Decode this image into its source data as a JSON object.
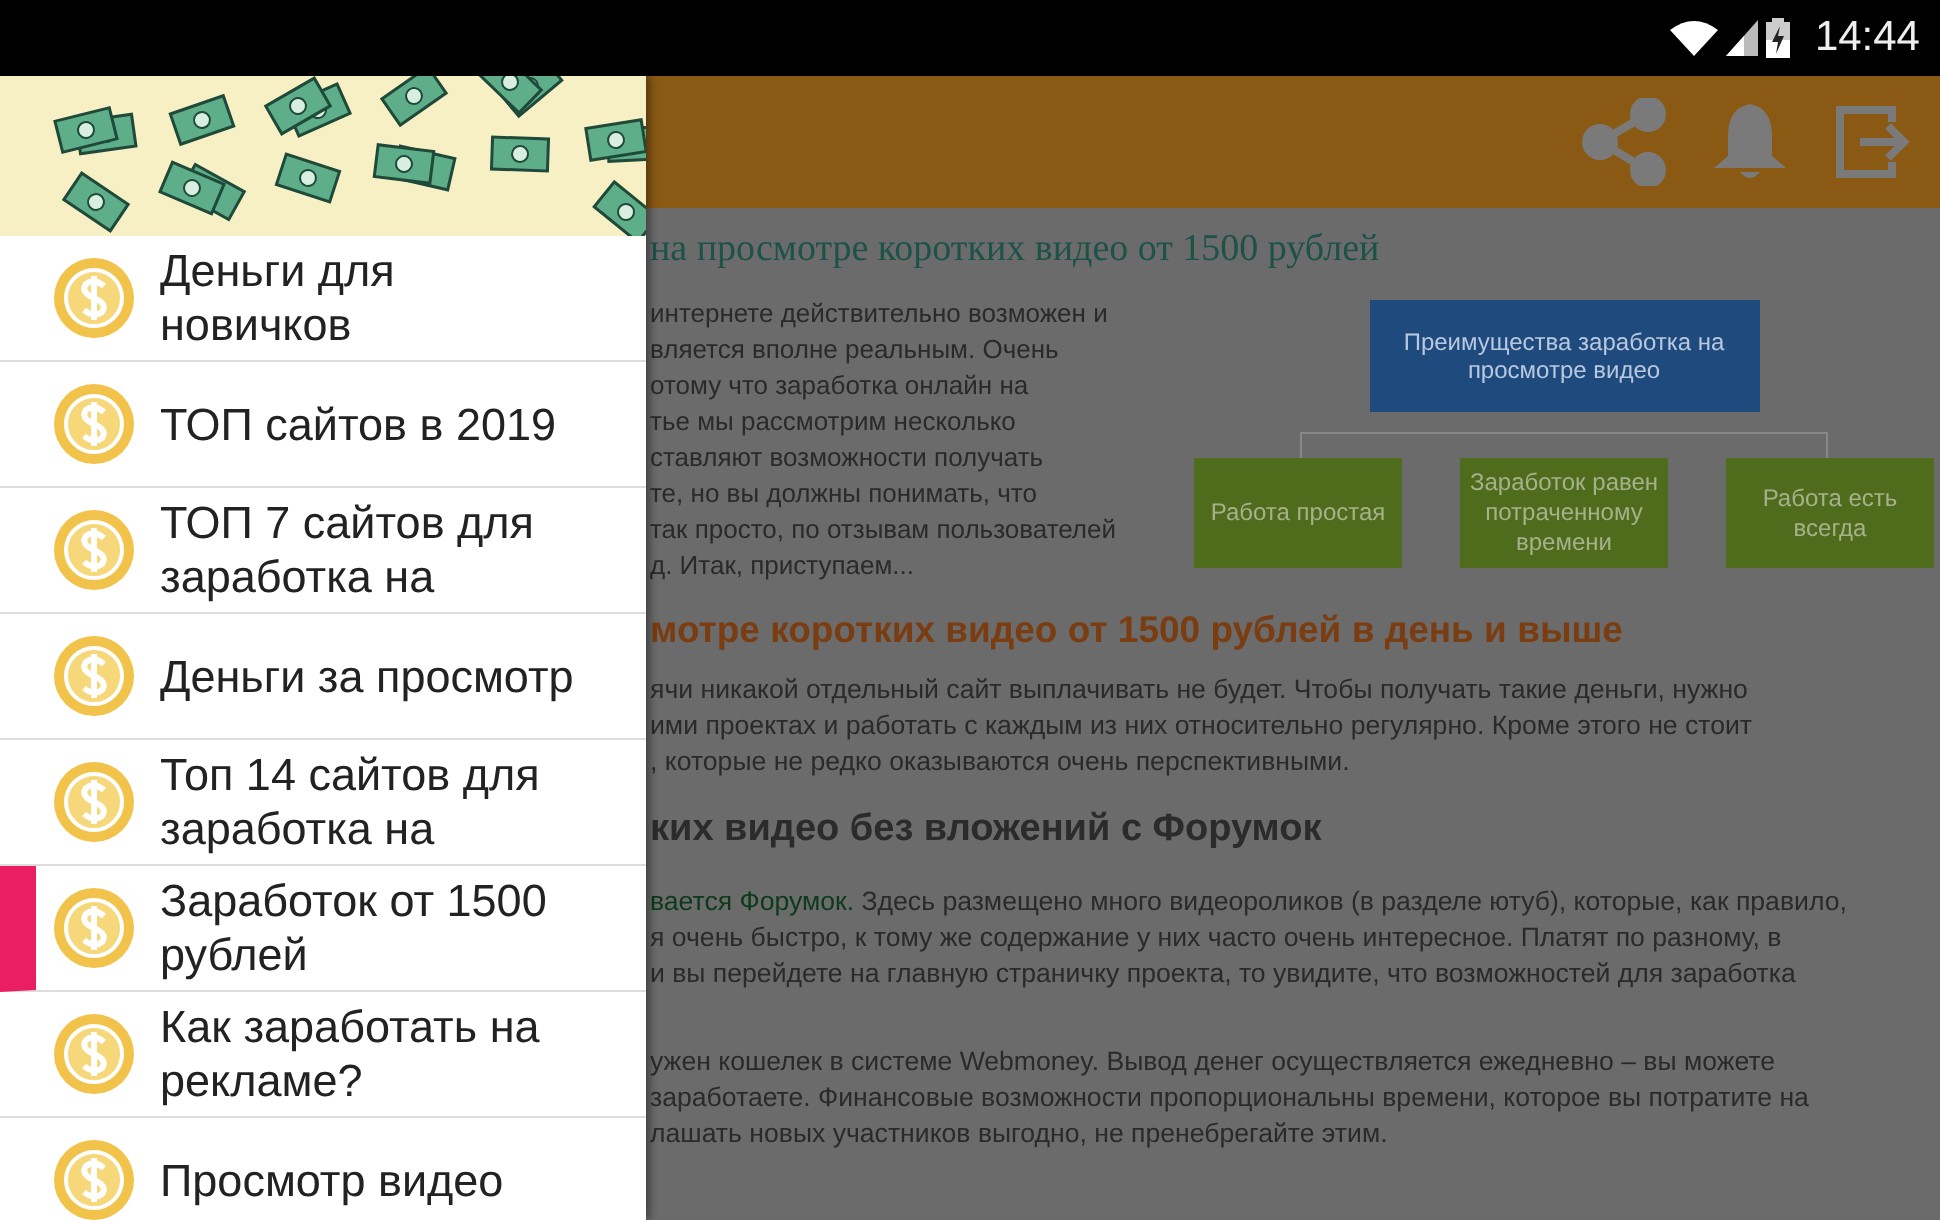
{
  "status_bar": {
    "time": "14:44"
  },
  "drawer": {
    "items": [
      {
        "label": "Деньги для новичков",
        "selected": false
      },
      {
        "label": "ТОП сайтов в 2019",
        "selected": false
      },
      {
        "label": "ТОП 7 сайтов для заработка на",
        "selected": false
      },
      {
        "label": "Деньги за просмотр",
        "selected": false
      },
      {
        "label": "Топ 14 сайтов для заработка на",
        "selected": false
      },
      {
        "label": "Заработок от 1500 рублей",
        "selected": true
      },
      {
        "label": "Как заработать на рекламе?",
        "selected": false
      },
      {
        "label": "Просмотр видео",
        "selected": false
      }
    ]
  },
  "article": {
    "title": "на просмотре коротких видео от 1500 рублей",
    "intro": [
      "интернете действительно возможен и",
      "вляется вполне реальным. Очень",
      "отому что заработка онлайн на",
      "тье мы рассмотрим несколько",
      "ставляют возможности получать",
      "те, но вы должны понимать, что",
      "так просто, по отзывам пользователей",
      "д. Итак, приступаем..."
    ],
    "diagram": {
      "root": "Преимущества заработка на просмотре видео",
      "leaves": [
        "Работа простая",
        "Заработок равен потраченному времени",
        "Работа есть всегда"
      ]
    },
    "heading_2": "мотре коротких видео от 1500 рублей в день и выше",
    "paragraph_2": [
      "ячи никакой отдельный сайт выплачивать не будет. Чтобы получать такие деньги, нужно",
      "ими проектах и работать с каждым из них относительно регулярно. Кроме этого не стоит",
      ", которые не редко оказываются очень перспективными."
    ],
    "heading_3": "ких видео без вложений с Форумок",
    "paragraph_3": {
      "link": "вается Форумок.",
      "lines": [
        "Здесь размещено много видеороликов (в разделе ютуб), которые, как правило,",
        "я очень быстро, к тому же содержание у них часто очень интересное. Платят по разному, в",
        "и вы перейдете на главную страничку проекта, то увидите, что возможностей для заработка"
      ]
    },
    "paragraph_4": [
      "ужен кошелек в системе Webmoney. Вывод денег осуществляется ежедневно – вы можете",
      "заработаете. Финансовые возможности пропорциональны времени, которое вы потратите на",
      "лашать новых участников выгодно, не пренебрегайте этим."
    ]
  }
}
